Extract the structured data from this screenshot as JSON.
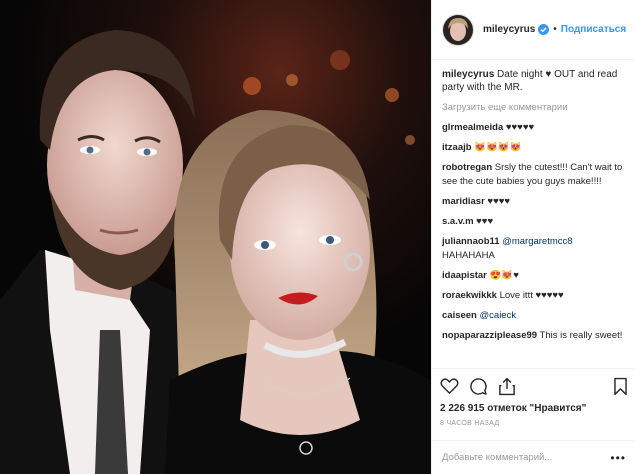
{
  "post": {
    "photo_description": ""
  },
  "header": {
    "username": "mileycyrus",
    "separator": "•",
    "follow_label": "Подписаться"
  },
  "caption": {
    "username": "mileycyrus",
    "text_line1": "Date night ♥ OUT and read",
    "text_line2": "party with the MR."
  },
  "load_more_label": "Загрузить еще комментарии",
  "comments": [
    {
      "user": "glrmealmeida",
      "text": "♥♥♥♥♥"
    },
    {
      "user": "itzaajb",
      "text": "😻😻😻😻"
    },
    {
      "user": "robotregan",
      "text": "Srsly the cutest!!! Can't wait to see the cute babies you guys make!!!!"
    },
    {
      "user": "maridiasr",
      "text": "♥♥♥♥"
    },
    {
      "user": "s.a.v.m",
      "text": "♥♥♥"
    },
    {
      "user": "juliannaob11",
      "mention": "@margaretmcc8",
      "text": "HAHAHAHA"
    },
    {
      "user": "idaapistar",
      "text": "😍😻♥"
    },
    {
      "user": "roraekwikkk",
      "text": "Love ittt ♥♥♥♥♥"
    },
    {
      "user": "caiseen",
      "mention": "@caieck",
      "text": ""
    },
    {
      "user": "nopaparazziplease99",
      "text": "This is really sweet!"
    }
  ],
  "likes": "2 226 915 отметок \"Нравится\"",
  "time_ago": "8 часов назад",
  "add_comment_placeholder": "Добавьте комментарий...",
  "more_options": "•••",
  "icons": [
    "heart-icon",
    "comment-icon",
    "share-icon",
    "bookmark-icon",
    "verified-badge-icon"
  ],
  "colors": {
    "accent": "#3897f0",
    "muted": "#999999",
    "text": "#262626"
  }
}
